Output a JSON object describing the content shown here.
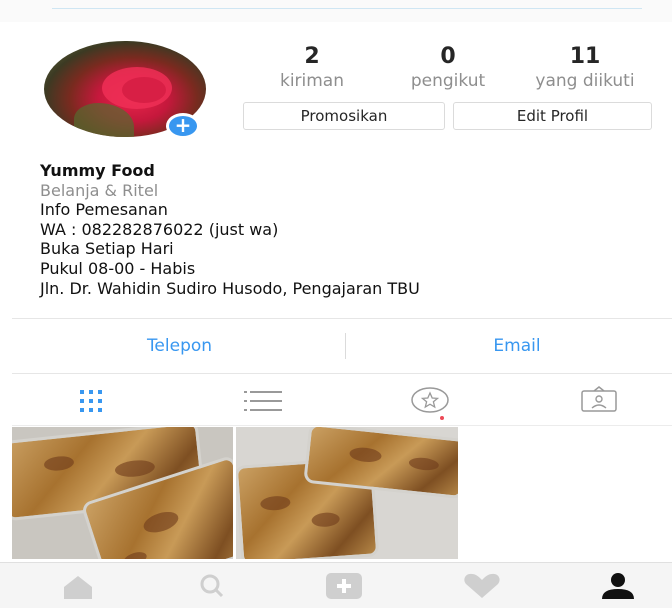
{
  "profile": {
    "avatar_icon": "rose-photo",
    "add_icon": "plus-icon",
    "stats": [
      {
        "count": "2",
        "label": "kiriman"
      },
      {
        "count": "0",
        "label": "pengikut"
      },
      {
        "count": "11",
        "label": "yang diikuti"
      }
    ],
    "promote_label": "Promosikan",
    "edit_label": "Edit Profil"
  },
  "bio": {
    "name": "Yummy Food",
    "category": "Belanja & Ritel",
    "lines": [
      "Info Pemesanan",
      "WA : 082282876022 (just wa)",
      "Buka Setiap Hari",
      "Pukul 08-00 - Habis",
      "Jln. Dr. Wahidin Sudiro Husodo, Pengajaran TBU"
    ]
  },
  "contact": {
    "phone_label": "Telepon",
    "email_label": "Email"
  },
  "tabs": {
    "icons": [
      "grid-icon",
      "list-icon",
      "tagged-star-icon",
      "saved-portrait-icon"
    ],
    "active": "grid-icon"
  },
  "posts": [
    {
      "icon": "food-photo"
    },
    {
      "icon": "food-photo"
    }
  ],
  "bottom_nav": {
    "icons": [
      "home-icon",
      "search-icon",
      "add-post-icon",
      "heart-icon",
      "profile-icon"
    ],
    "active": "profile-icon"
  },
  "colors": {
    "accent": "#3897f0",
    "notification": "#ed4956",
    "muted": "#8e8e8e"
  }
}
